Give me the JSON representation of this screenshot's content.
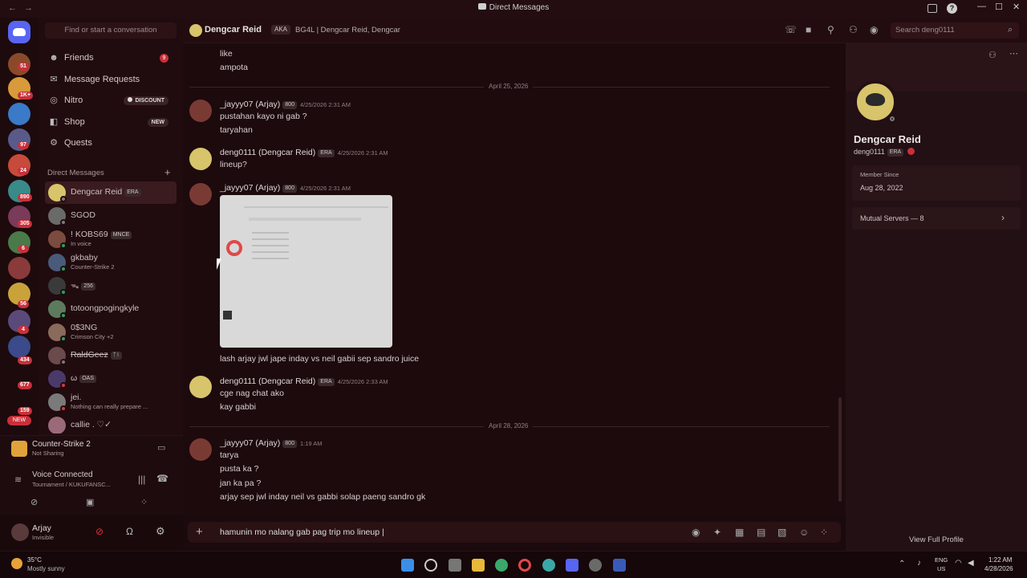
{
  "window": {
    "title": "Direct Messages",
    "nav_back": "←",
    "nav_fwd": "→",
    "help": "?",
    "minimize": "—",
    "maximize": "☐",
    "close": "✕"
  },
  "servers": {
    "badges": [
      "51",
      "1K+",
      "97",
      "24",
      "890",
      "305",
      "6",
      "56",
      "4",
      "434",
      "677",
      "159"
    ],
    "new_label": "NEW"
  },
  "sidebar": {
    "find_placeholder": "Find or start a conversation",
    "nav": [
      {
        "label": "Friends",
        "badge": "9"
      },
      {
        "label": "Message Requests"
      },
      {
        "label": "Nitro",
        "pill": "DISCOUNT"
      },
      {
        "label": "Shop",
        "pill": "NEW"
      },
      {
        "label": "Quests"
      }
    ],
    "dm_header": "Direct Messages",
    "dm_plus": "+",
    "dms": [
      {
        "name": "Dengcar Reid",
        "tag": "ERA"
      },
      {
        "name": "SGOD"
      },
      {
        "name": "! KOBS69",
        "tag": "MNCE",
        "sub": "In voice"
      },
      {
        "name": "gkbaby",
        "sub": "Counter-Strike 2"
      },
      {
        "name": "ᯓ",
        "tag": "256"
      },
      {
        "name": "totoongpogingkyle"
      },
      {
        "name": "0$3NG",
        "sub": "Crimson City +2"
      },
      {
        "name": "RaldGeez",
        "tag": "ᛉᚾ"
      },
      {
        "name": "ω",
        "tag": "OAS"
      },
      {
        "name": "jei.",
        "sub": "Nothing can really prepare ..."
      },
      {
        "name": "callie . ♡✓"
      }
    ]
  },
  "activity": {
    "game": "Counter-Strike 2",
    "status": "Not Sharing",
    "voice_status": "Voice Connected",
    "voice_channel": "Tournament / KUKUFANSC..."
  },
  "user": {
    "name": "Arjay",
    "status": "Invisible"
  },
  "chat_header": {
    "name": "Dengcar Reid",
    "aka_label": "AKA",
    "aka": "BG4L | Dengcar Reid, Dengcar",
    "search_placeholder": "Search deng0111"
  },
  "messages": {
    "top_lines": [
      "like",
      "ampota"
    ],
    "date1": "April 25, 2026",
    "m1": {
      "name": "_jayyy07 (Arjay)",
      "tag": "800",
      "time": "4/25/2026 2:31 AM",
      "lines": [
        "pustahan kayo ni gab ?",
        "taryahan"
      ]
    },
    "m2": {
      "name": "deng0111 (Dengcar Reid)",
      "tag": "ERA",
      "time": "4/25/2026 2:31 AM",
      "lines": [
        "lineup?"
      ]
    },
    "m3": {
      "name": "_jayyy07 (Arjay)",
      "tag": "800",
      "time": "4/25/2026 2:31 AM",
      "caption": "lash arjay jwl jape inday vs neil gabii sep sandro juice"
    },
    "m4": {
      "name": "deng0111 (Dengcar Reid)",
      "tag": "ERA",
      "time": "4/25/2026 2:33 AM",
      "lines": [
        "cge nag chat ako",
        "kay gabbi"
      ]
    },
    "date2": "April 28, 2026",
    "m5": {
      "name": "_jayyy07 (Arjay)",
      "tag": "800",
      "time": "1:19 AM",
      "lines": [
        "tarya",
        "pusta ka ?",
        "jan ka pa ?",
        "arjay sep jwl inday neil vs gabbi solap paeng sandro gk"
      ]
    }
  },
  "composer": {
    "value": "hamunin mo nalang gab pag trip mo lineup |",
    "plus": "+"
  },
  "profile": {
    "name": "Dengcar Reid",
    "username": "deng0111",
    "tag": "ERA",
    "member_since_label": "Member Since",
    "member_since": "Aug 28, 2022",
    "mutual": "Mutual Servers — 8",
    "view_full": "View Full Profile"
  },
  "taskbar": {
    "temp": "35°C",
    "weather": "Mostly sunny",
    "lang1": "ENG",
    "lang2": "US",
    "time": "1:22 AM",
    "date": "4/28/2026"
  },
  "colors": {
    "accent": "#c9303a",
    "online": "#23a55a",
    "background": "#1c0a0d"
  }
}
